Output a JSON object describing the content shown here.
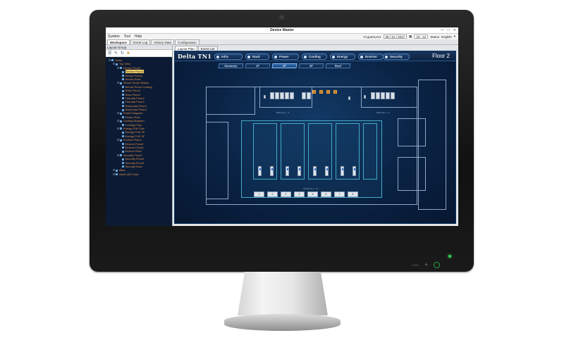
{
  "app": {
    "window_title": "Device Master",
    "menus": [
      "System",
      "Tool",
      "Help"
    ],
    "user": "Hi guest,en1",
    "date": "06 / 21 / 2017",
    "time": "10 : 12",
    "status_label": "Status",
    "language": "English",
    "win_controls": [
      "—",
      "□",
      "✕"
    ]
  },
  "tabs": [
    "Workspace",
    "Event Log",
    "History Data",
    "Configuration"
  ],
  "left_panel": {
    "header": "Layout Group",
    "tree": [
      {
        "label": "Home",
        "depth": 0,
        "icon": "home-icon"
      },
      {
        "label": "Top View",
        "depth": 1,
        "icon": "map-icon"
      },
      {
        "label": "Device Floor2",
        "depth": 2,
        "icon": "folder-icon"
      },
      {
        "label": "Device Floor2",
        "depth": 3,
        "icon": "device-icon",
        "selected": true
      },
      {
        "label": "Device Floor2",
        "depth": 3,
        "icon": "device-icon"
      },
      {
        "label": "Device Roof",
        "depth": 3,
        "icon": "device-icon"
      },
      {
        "label": "Server Room Status",
        "depth": 2,
        "icon": "folder-icon"
      },
      {
        "label": "Server Room Cooling",
        "depth": 3,
        "icon": "cooling-icon"
      },
      {
        "label": "Rack Floor2",
        "depth": 3,
        "icon": "rack-icon"
      },
      {
        "label": "Rack Floor2",
        "depth": 3,
        "icon": "rack-icon"
      },
      {
        "label": "Thermal Floor2",
        "depth": 3,
        "icon": "thermal-icon"
      },
      {
        "label": "Thermal Floor3",
        "depth": 3,
        "icon": "thermal-icon"
      },
      {
        "label": "RackLoad Floor2",
        "depth": 3,
        "icon": "rack-icon"
      },
      {
        "label": "RackLoad Floor3",
        "depth": 3,
        "icon": "rack-icon"
      },
      {
        "label": "Power Diagram",
        "depth": 2,
        "icon": "folder-icon"
      },
      {
        "label": "Power Flow",
        "depth": 3,
        "icon": "power-icon"
      },
      {
        "label": "Cooling Diagram",
        "depth": 2,
        "icon": "folder-icon"
      },
      {
        "label": "Cooling Flow",
        "depth": 3,
        "icon": "cooling-icon"
      },
      {
        "label": "Energy PUE Site",
        "depth": 2,
        "icon": "folder-icon"
      },
      {
        "label": "Energy PUE 2F",
        "depth": 3,
        "icon": "energy-icon"
      },
      {
        "label": "Energy PUE 3F",
        "depth": 3,
        "icon": "energy-icon"
      },
      {
        "label": "Environ Floor2",
        "depth": 2,
        "icon": "folder-icon"
      },
      {
        "label": "Environ Floor2",
        "depth": 3,
        "icon": "environ-icon"
      },
      {
        "label": "Environ Floor3",
        "depth": 3,
        "icon": "environ-icon"
      },
      {
        "label": "Environ Roof",
        "depth": 3,
        "icon": "environ-icon"
      },
      {
        "label": "Security Floor2",
        "depth": 2,
        "icon": "folder-icon"
      },
      {
        "label": "Security Floor2",
        "depth": 3,
        "icon": "security-icon"
      },
      {
        "label": "Security Floor3",
        "depth": 3,
        "icon": "security-icon"
      },
      {
        "label": "Security Roof",
        "depth": 3,
        "icon": "security-icon"
      },
      {
        "label": "Alias",
        "depth": 1,
        "icon": "folder-icon"
      },
      {
        "label": "Asset QR Code",
        "depth": 1,
        "icon": "qr-icon"
      }
    ]
  },
  "right_tabs": [
    "Layout Plan",
    "Event List"
  ],
  "view": {
    "brand": "Delta TN1",
    "floor": "Floor 2",
    "nav": [
      "Infra",
      "Rack",
      "Power",
      "Cooling",
      "Energy",
      "Environ",
      "Security"
    ],
    "sub_nav": [
      "Summary",
      "1F",
      "2F",
      "3F",
      "Roof"
    ],
    "active_sub": "2F",
    "ups_labels": [
      "UPS A1-1 ~ 3",
      "UPS A1-1 ~ 3"
    ],
    "coil_label": "COOL A1-1 ~ 8",
    "coils": [
      "1",
      "2",
      "3",
      "4",
      "5",
      "6",
      "7",
      "8"
    ]
  },
  "colors": {
    "tree_text": "#e08c4a",
    "selected": "#f7d36a",
    "view_bg": "#0a2446",
    "accent": "#44a9c8"
  }
}
